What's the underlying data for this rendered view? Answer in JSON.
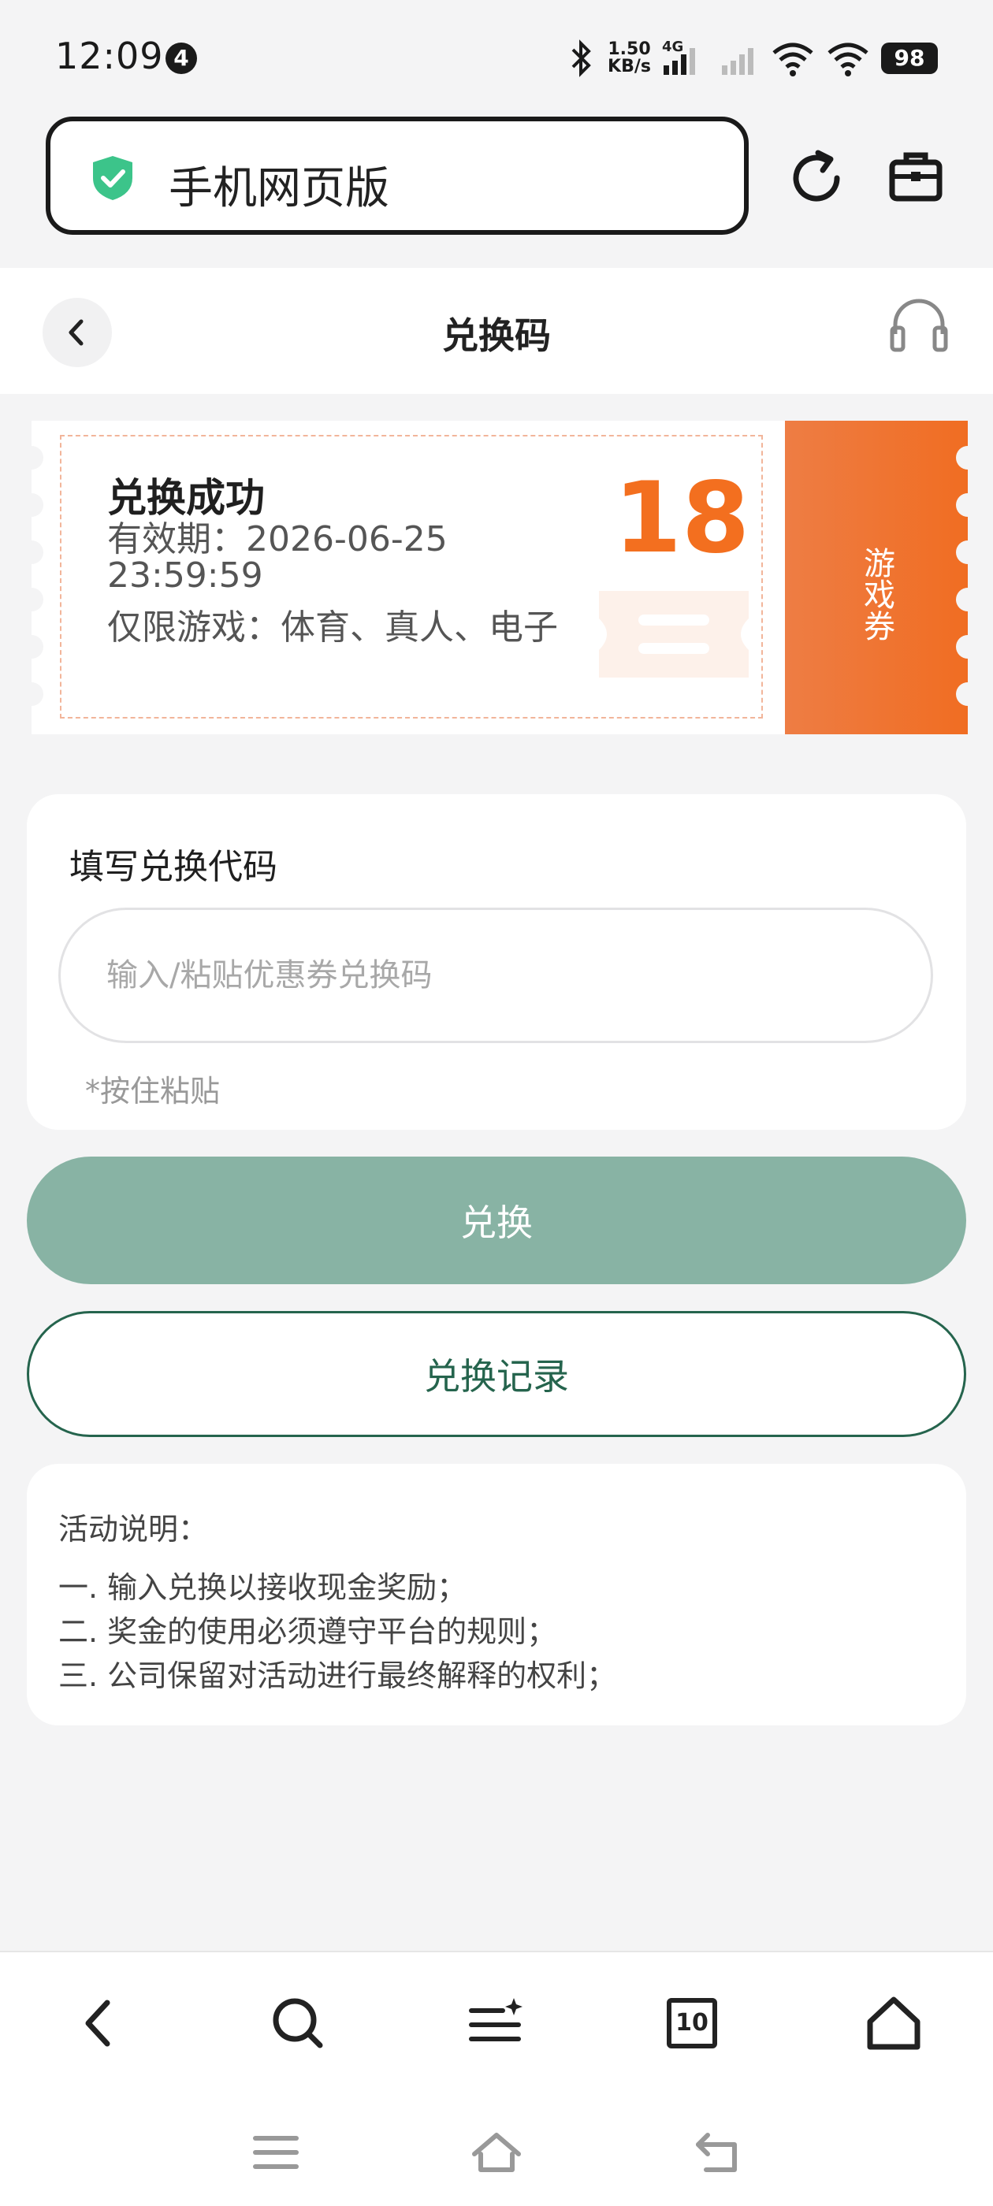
{
  "status_bar": {
    "time": "12:09",
    "notification_count": "4",
    "net_speed_value": "1.50",
    "net_speed_unit": "KB/s",
    "network_type": "4G",
    "battery": "98"
  },
  "browser": {
    "url_title": "手机网页版"
  },
  "header": {
    "title": "兑换码"
  },
  "coupon": {
    "status": "兑换成功",
    "validity": "有效期：2026-06-25 23:59:59",
    "scope": "仅限游戏：体育、真人、电子",
    "amount": "18",
    "type_label": "游戏券"
  },
  "redeem_form": {
    "label": "填写兑换代码",
    "placeholder": "输入/粘贴优惠券兑换码",
    "value": "",
    "hint": "*按住粘贴"
  },
  "buttons": {
    "redeem": "兑换",
    "history": "兑换记录"
  },
  "notes": {
    "title": "活动说明：",
    "items": [
      "一. 输入兑换以接收现金奖励；",
      "二. 奖金的使用必须遵守平台的规则；",
      "三. 公司保留对活动进行最终解释的权利；"
    ]
  },
  "bottom_nav": {
    "tab_count": "10"
  },
  "colors": {
    "brand_green": "#25644d",
    "button_green": "#88b3a4",
    "coupon_orange": "#f36f1f",
    "shield_green": "#3cc48a"
  }
}
